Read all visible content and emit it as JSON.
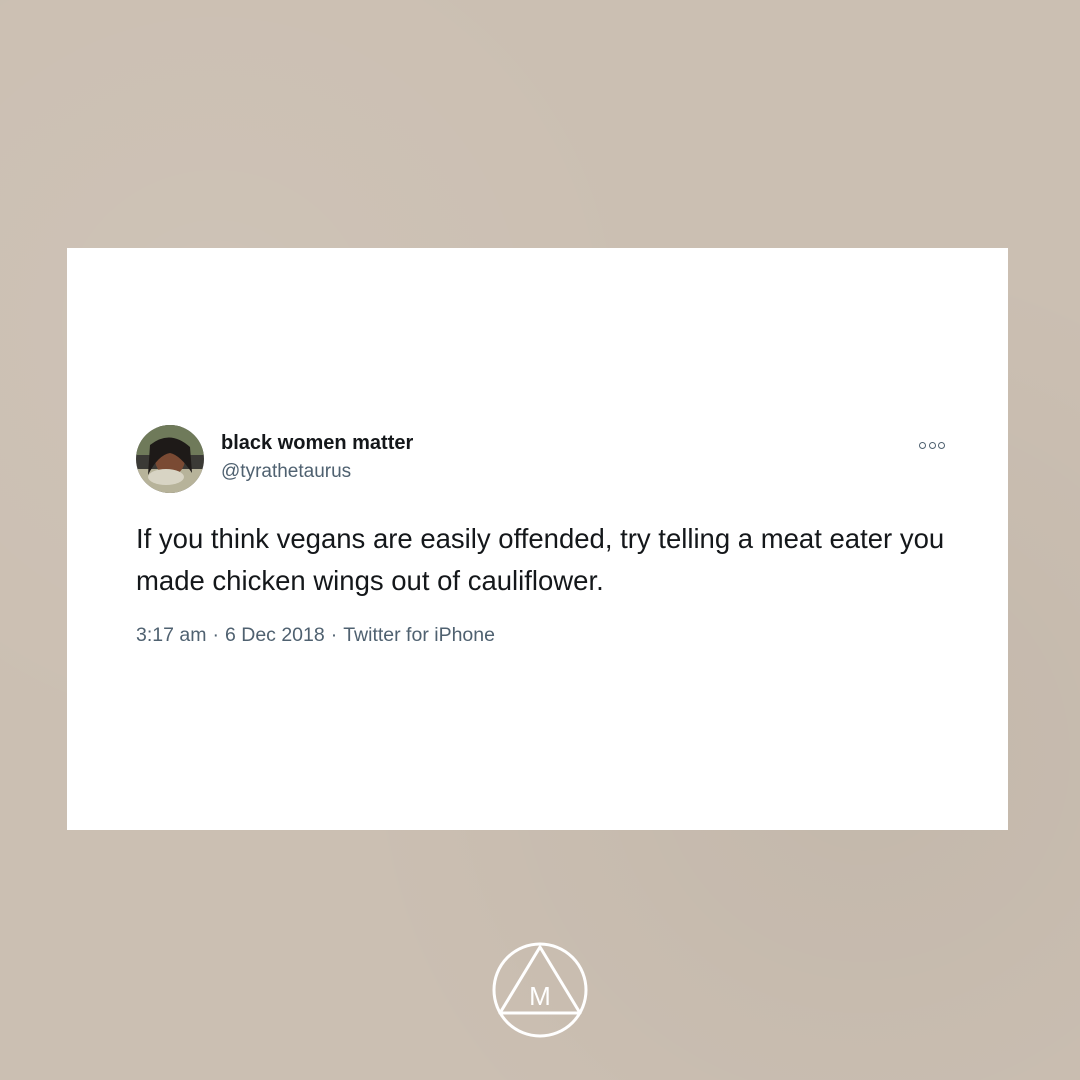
{
  "tweet": {
    "display_name": "black women matter",
    "handle": "@tyrathetaurus",
    "text": "If you think vegans are easily offended, try telling a meat eater you made chicken wings out of cauliflower.",
    "time": "3:17 am",
    "date": "6 Dec 2018",
    "source": "Twitter for iPhone",
    "separator": "·",
    "more_icon": "more-options-icon"
  },
  "brand": {
    "logo_letter": "M",
    "logo_icon": "triangle-circle-logo"
  },
  "colors": {
    "background": "#cbbfb2",
    "card": "#ffffff",
    "text": "#14171a",
    "secondary_text": "#4f6170",
    "logo": "#ffffff"
  }
}
